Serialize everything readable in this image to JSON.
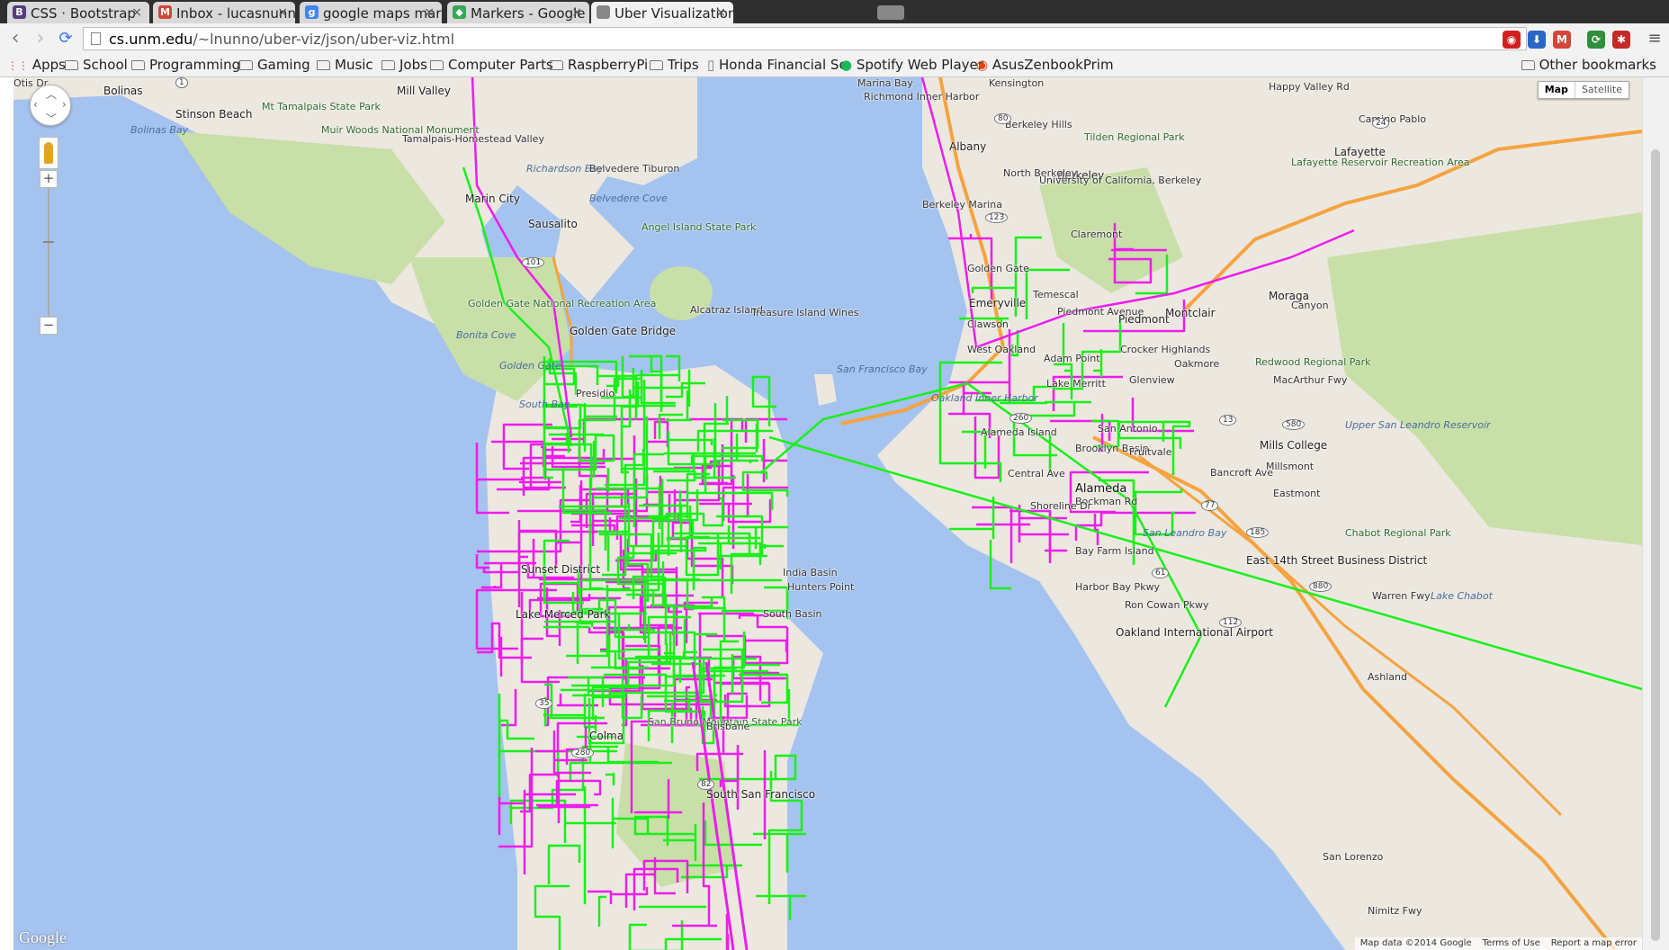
{
  "browser": {
    "tabs": [
      {
        "title": "CSS · Bootstrap",
        "icon": "bootstrap-icon",
        "icon_text": "B",
        "color": "#563d7c"
      },
      {
        "title": "Inbox - lucasnunno@g",
        "icon": "gmail-icon",
        "icon_text": "M",
        "color": "#d44638"
      },
      {
        "title": "google maps markers",
        "icon": "google-search-icon",
        "icon_text": "g",
        "color": "#4285f4"
      },
      {
        "title": "Markers - Google Map",
        "icon": "google-developers-icon",
        "icon_text": "◆",
        "color": "#34a853"
      },
      {
        "title": "Uber Visualization",
        "icon": "page-icon",
        "icon_text": "",
        "color": "#888888"
      }
    ],
    "url_host": "cs.unm.edu",
    "url_path": "/~lnunno/uber-viz/json/uber-viz.html",
    "extensions": [
      {
        "name": "adblock-icon",
        "color": "#d11f1f",
        "text": "◉"
      },
      {
        "name": "download-icon",
        "color": "#2a66c4",
        "text": "⬇"
      },
      {
        "name": "gmail-checker-icon",
        "color": "#d44638",
        "text": "M"
      },
      {
        "name": "refresh-extension-icon",
        "color": "#2f8f3a",
        "text": "⟳"
      },
      {
        "name": "notification-extension-icon",
        "color": "#c62828",
        "text": "✱"
      }
    ],
    "bookmarks": [
      {
        "label": "Apps",
        "icon": "apps-grid-icon"
      },
      {
        "label": "School",
        "icon": "folder-icon"
      },
      {
        "label": "Programming",
        "icon": "folder-icon"
      },
      {
        "label": "Gaming",
        "icon": "folder-icon"
      },
      {
        "label": "Music",
        "icon": "folder-icon"
      },
      {
        "label": "Jobs",
        "icon": "folder-icon"
      },
      {
        "label": "Computer Parts",
        "icon": "folder-icon"
      },
      {
        "label": "RaspberryPi",
        "icon": "folder-icon"
      },
      {
        "label": "Trips",
        "icon": "folder-icon"
      },
      {
        "label": "Honda Financial Se",
        "icon": "page-icon"
      },
      {
        "label": "Spotify Web Player",
        "icon": "spotify-icon"
      },
      {
        "label": "AsusZenbookPrim",
        "icon": "ubuntu-icon"
      }
    ],
    "other_bookmarks": "Other bookmarks"
  },
  "map": {
    "map_type": {
      "selected": "Map",
      "other": "Satellite"
    },
    "footer": [
      "Map data ©2014 Google",
      "Terms of Use",
      "Report a map error"
    ],
    "logo": "Google",
    "colors": {
      "water": "#a4c3ef",
      "land": "#ece8df",
      "park": "#c8dfa8",
      "route_a": "#19f019",
      "route_b": "#ee1cee",
      "highway": "#f5a340"
    },
    "labels": [
      "Bolinas",
      "Stinson Beach",
      "Bolinas Bay",
      "Mt Tamalpais State Park",
      "Muir Woods National Monument",
      "Mill Valley",
      "Tamalpais-Homestead Valley",
      "Marin City",
      "Richardson Bay",
      "Belvedere Tiburon",
      "Belvedere Cove",
      "Sausalito",
      "Angel Island State Park",
      "Golden Gate National Recreation Area",
      "Bonita Cove",
      "Golden Gate Bridge",
      "Golden Gate",
      "Alcatraz Island",
      "Treasure Island Wines",
      "South Bay",
      "Presidio",
      "Sunset District",
      "Lake Merced Park",
      "India Basin",
      "Hunters Point",
      "South Basin",
      "San Bruno Mountain State Park",
      "Colma",
      "South San Francisco",
      "Brisbane",
      "San Francisco Bay",
      "Oakland Inner Harbor",
      "Alameda Island",
      "Alameda",
      "Central Ave",
      "Brooklyn Basin",
      "Marina Bay",
      "Richmond Inner Harbor",
      "Kensington",
      "Albany",
      "Berkeley",
      "Berkeley Hills",
      "North Berkeley",
      "University of California, Berkeley",
      "Tilden Regional Park",
      "Berkeley Marina",
      "Emeryville",
      "Golden Gate",
      "Claremont",
      "Temescal",
      "Piedmont Avenue",
      "Piedmont",
      "Clawson",
      "West Oakland",
      "Adam Point",
      "Lake Merritt",
      "Crocker Highlands",
      "Glenview",
      "Oakmore",
      "Montclair",
      "Moraga",
      "Canyon",
      "Redwood Regional Park",
      "Lafayette",
      "Lafayette Reservoir Recreation Area",
      "Happy Valley Rd",
      "Camino Pablo",
      "Mills College",
      "Millsmont",
      "Fruitvale",
      "San Antonio",
      "Eastmont",
      "Chabot Regional Park",
      "Upper San Leandro Reservoir",
      "East 14th Street Business District",
      "Lake Chabot",
      "Ashland",
      "San Lorenzo",
      "Oakland International Airport",
      "San Leandro Bay",
      "Bay Farm Island",
      "Harbor Bay Pkwy",
      "Ron Cowan Pkwy",
      "Bancroft Ave",
      "MacArthur Fwy",
      "Warren Fwy",
      "Nimitz Fwy",
      "Bockman Rd",
      "Shoreline Dr",
      "Otis Dr"
    ],
    "route_labels": [
      "1",
      "101",
      "80",
      "580",
      "880",
      "24",
      "13",
      "77",
      "185",
      "61",
      "112",
      "35",
      "82",
      "280",
      "123",
      "260"
    ]
  }
}
